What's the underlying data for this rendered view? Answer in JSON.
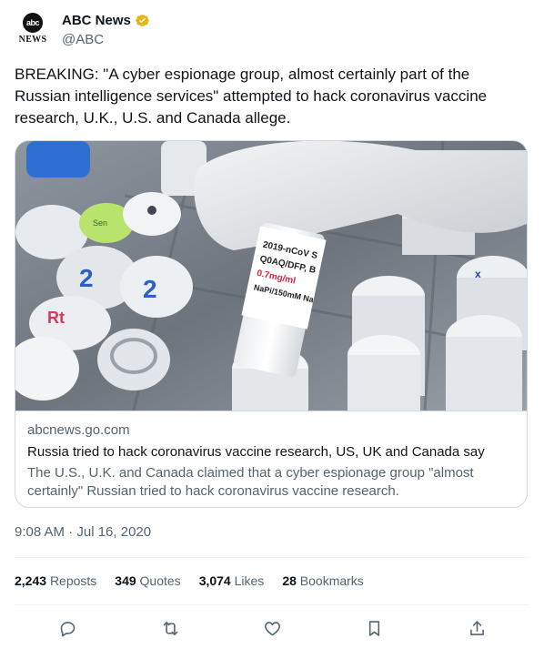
{
  "author": {
    "display_name": "ABC News",
    "handle": "@ABC",
    "avatar_text": "abc",
    "avatar_subtext": "NEWS"
  },
  "tweet": {
    "text": "BREAKING: \"A cyber espionage group, almost certainly part of the\nRussian intelligence services\" attempted to hack coronavirus vaccine\nresearch, U.K., U.S. and Canada allege."
  },
  "card": {
    "image_label_lines": [
      "2019-nCoV S",
      "Q0AQ/DFP, B",
      "0.7mg/ml",
      "NaPi/150mM Na"
    ],
    "domain": "abcnews.go.com",
    "title": "Russia tried to hack coronavirus vaccine research, US, UK and Canada say",
    "description": "The U.S., U.K. and Canada claimed that a cyber espionage group \"almost certainly\" Russian tried to hack coronavirus vaccine research."
  },
  "timestamp": "9:08 AM · Jul 16, 2020",
  "stats": {
    "reposts_count": "2,243",
    "reposts_label": "Reposts",
    "quotes_count": "349",
    "quotes_label": "Quotes",
    "likes_count": "3,074",
    "likes_label": "Likes",
    "bookmarks_count": "28",
    "bookmarks_label": "Bookmarks"
  },
  "actions": [
    "reply-icon",
    "repost-icon",
    "like-icon",
    "bookmark-icon",
    "share-icon"
  ],
  "colors": {
    "secondary_text": "#536471",
    "border": "#cfd9de",
    "verified_gold": "#e2b719"
  }
}
